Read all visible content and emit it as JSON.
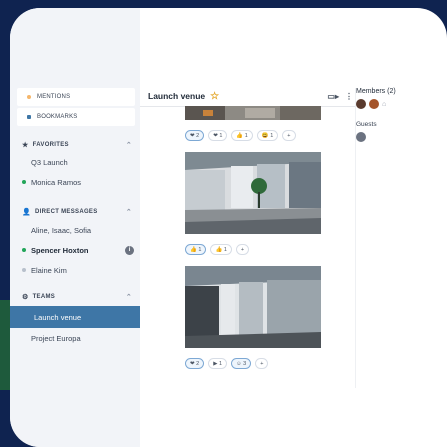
{
  "sidebar": {
    "mentions_label": "MENTIONS",
    "bookmarks_label": "BOOKMARKS",
    "favorites": {
      "label": "FAVORITES",
      "items": [
        "Q3 Launch",
        "Monica Ramos"
      ]
    },
    "direct_messages": {
      "label": "DIRECT MESSAGES",
      "items": [
        "Aline, Isaac, Sofia",
        "Spencer Hoxton",
        "Elaine Kim"
      ]
    },
    "teams": {
      "label": "TEAMS",
      "items": [
        "Launch venue",
        "Project Europa"
      ]
    },
    "colors": {
      "accent": "#3e76a6",
      "mentions_dot": "#f5b66b",
      "bookmarks_dot": "#3e76a6",
      "online": "#22a559"
    }
  },
  "header": {
    "title": "Launch venue",
    "star_icon": "star-icon",
    "video_icon": "video-icon",
    "more_icon": "more-icon"
  },
  "messages": {
    "reactions_1": [
      "❤ 2",
      "❤ 1",
      "👍 1",
      "😃 1",
      "+"
    ],
    "reactions_2": [
      "👍 1",
      "👍 1",
      "+"
    ],
    "reactions_3": [
      "❤ 2",
      "▶ 1",
      "☺ 3",
      "+"
    ]
  },
  "members": {
    "title": "Members (2)",
    "guests_label": "Guests"
  }
}
